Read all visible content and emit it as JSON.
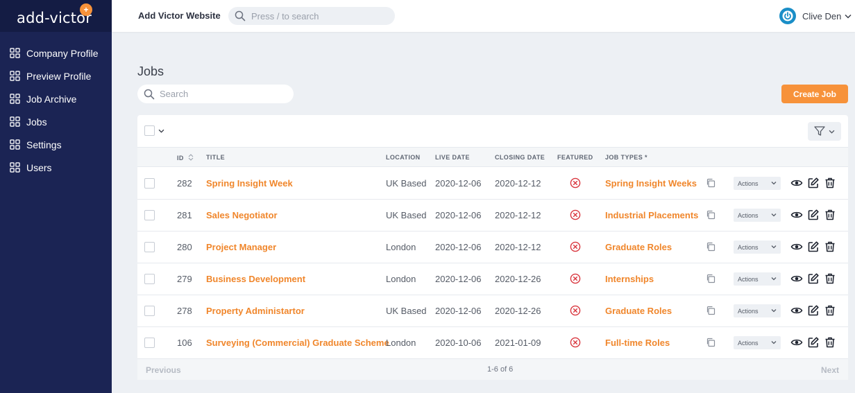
{
  "brand": {
    "name": "add-victor",
    "badge": "+"
  },
  "sidebar": {
    "items": [
      {
        "label": "Company Profile"
      },
      {
        "label": "Preview Profile"
      },
      {
        "label": "Job Archive"
      },
      {
        "label": "Jobs"
      },
      {
        "label": "Settings"
      },
      {
        "label": "Users"
      }
    ]
  },
  "header": {
    "title": "Add Victor Website",
    "search_placeholder": "Press / to search",
    "user_name": "Clive Den"
  },
  "page": {
    "title": "Jobs",
    "search_placeholder": "Search",
    "create_label": "Create Job"
  },
  "table": {
    "headers": {
      "id": "ID",
      "title": "TITLE",
      "location": "LOCATION",
      "live_date": "LIVE DATE",
      "closing_date": "CLOSING DATE",
      "featured": "FEATURED",
      "job_types": "JOB TYPES *"
    },
    "actions_label": "Actions",
    "rows": [
      {
        "id": "282",
        "title": "Spring Insight Week",
        "location": "UK Based",
        "live_date": "2020-12-06",
        "closing_date": "2020-12-12",
        "job_type": "Spring Insight Weeks"
      },
      {
        "id": "281",
        "title": "Sales Negotiator",
        "location": "UK Based",
        "live_date": "2020-12-06",
        "closing_date": "2020-12-12",
        "job_type": "Industrial Placements"
      },
      {
        "id": "280",
        "title": "Project Manager",
        "location": "London",
        "live_date": "2020-12-06",
        "closing_date": "2020-12-12",
        "job_type": "Graduate Roles"
      },
      {
        "id": "279",
        "title": "Business Development",
        "location": "London",
        "live_date": "2020-12-06",
        "closing_date": "2020-12-26",
        "job_type": "Internships"
      },
      {
        "id": "278",
        "title": "Property Administartor",
        "location": "UK Based",
        "live_date": "2020-12-06",
        "closing_date": "2020-12-26",
        "job_type": "Graduate Roles"
      },
      {
        "id": "106",
        "title": "Surveying (Commercial) Graduate Scheme",
        "location": "London",
        "live_date": "2020-10-06",
        "closing_date": "2021-01-09",
        "job_type": "Full-time Roles"
      }
    ]
  },
  "pager": {
    "prev": "Previous",
    "info": "1-6 of 6",
    "next": "Next"
  },
  "colors": {
    "sidebar": "#1b2454",
    "accent": "#f7923a",
    "featured_no": "#d9363e",
    "avatar": "#1a8ec7"
  }
}
